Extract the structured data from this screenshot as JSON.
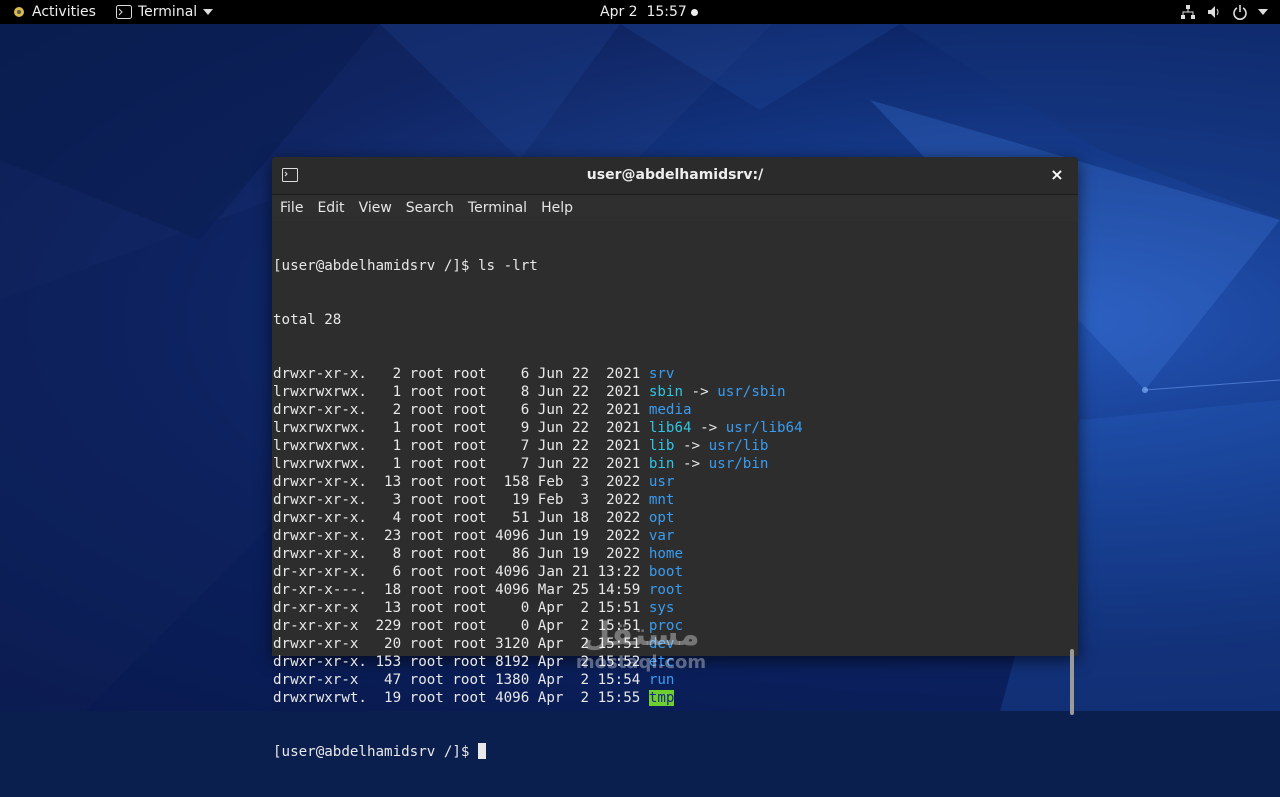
{
  "topbar": {
    "activities_label": "Activities",
    "app_label": "Terminal",
    "clock": "Apr 2  15:57"
  },
  "window": {
    "title": "user@abdelhamidsrv:/",
    "close_glyph": "×",
    "menu": [
      "File",
      "Edit",
      "View",
      "Search",
      "Terminal",
      "Help"
    ]
  },
  "terminal": {
    "prompt": "[user@abdelhamidsrv /]$ ",
    "command": "ls -lrt",
    "total": "total 28",
    "entries": [
      {
        "meta": "drwxr-xr-x.   2 root root    6 Jun 22  2021 ",
        "name": "srv",
        "color": "blue"
      },
      {
        "meta": "lrwxrwxrwx.   1 root root    8 Jun 22  2021 ",
        "name": "sbin",
        "color": "cyan",
        "arrow": " -> ",
        "target": "usr/sbin"
      },
      {
        "meta": "drwxr-xr-x.   2 root root    6 Jun 22  2021 ",
        "name": "media",
        "color": "blue"
      },
      {
        "meta": "lrwxrwxrwx.   1 root root    9 Jun 22  2021 ",
        "name": "lib64",
        "color": "cyan",
        "arrow": " -> ",
        "target": "usr/lib64"
      },
      {
        "meta": "lrwxrwxrwx.   1 root root    7 Jun 22  2021 ",
        "name": "lib",
        "color": "cyan",
        "arrow": " -> ",
        "target": "usr/lib"
      },
      {
        "meta": "lrwxrwxrwx.   1 root root    7 Jun 22  2021 ",
        "name": "bin",
        "color": "cyan",
        "arrow": " -> ",
        "target": "usr/bin"
      },
      {
        "meta": "drwxr-xr-x.  13 root root  158 Feb  3  2022 ",
        "name": "usr",
        "color": "blue"
      },
      {
        "meta": "drwxr-xr-x.   3 root root   19 Feb  3  2022 ",
        "name": "mnt",
        "color": "blue"
      },
      {
        "meta": "drwxr-xr-x.   4 root root   51 Jun 18  2022 ",
        "name": "opt",
        "color": "blue"
      },
      {
        "meta": "drwxr-xr-x.  23 root root 4096 Jun 19  2022 ",
        "name": "var",
        "color": "blue"
      },
      {
        "meta": "drwxr-xr-x.   8 root root   86 Jun 19  2022 ",
        "name": "home",
        "color": "blue"
      },
      {
        "meta": "dr-xr-xr-x.   6 root root 4096 Jan 21 13:22 ",
        "name": "boot",
        "color": "blue"
      },
      {
        "meta": "dr-xr-x---.  18 root root 4096 Mar 25 14:59 ",
        "name": "root",
        "color": "blue"
      },
      {
        "meta": "dr-xr-xr-x   13 root root    0 Apr  2 15:51 ",
        "name": "sys",
        "color": "blue"
      },
      {
        "meta": "dr-xr-xr-x  229 root root    0 Apr  2 15:51 ",
        "name": "proc",
        "color": "blue"
      },
      {
        "meta": "drwxr-xr-x   20 root root 3120 Apr  2 15:51 ",
        "name": "dev",
        "color": "blue"
      },
      {
        "meta": "drwxr-xr-x. 153 root root 8192 Apr  2 15:52 ",
        "name": "etc",
        "color": "blue"
      },
      {
        "meta": "drwxr-xr-x   47 root root 1380 Apr  2 15:54 ",
        "name": "run",
        "color": "blue"
      },
      {
        "meta": "drwxrwxrwt.  19 root root 4096 Apr  2 15:55 ",
        "name": "tmp",
        "color": "tmp"
      }
    ],
    "final_prompt": "[user@abdelhamidsrv /]$ "
  },
  "watermark": {
    "logo": "مستقل",
    "text": "mostaql.com"
  },
  "colors": {
    "blue": "#3a9cf0",
    "cyan": "#32c4e4",
    "tmp_bg": "#6fcf2e"
  }
}
